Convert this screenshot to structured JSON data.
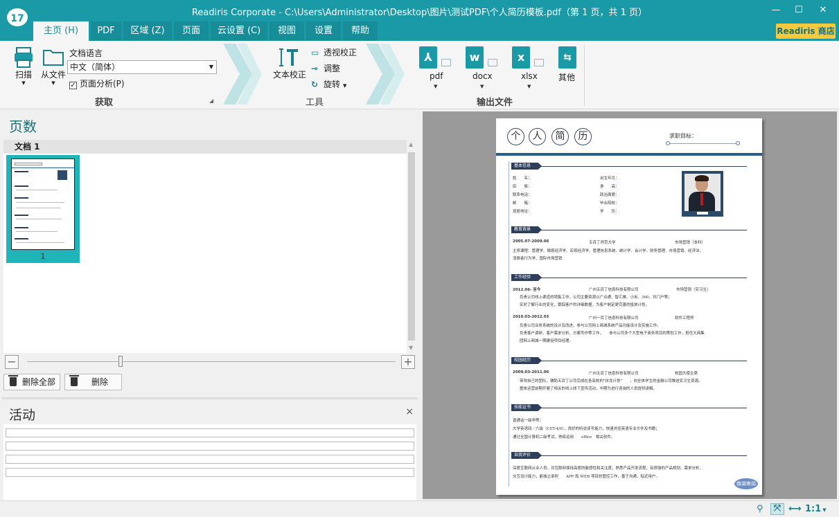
{
  "window": {
    "logo": "17",
    "title": "Readiris Corporate - C:\\Users\\Administrator\\Desktop\\图片\\测试PDF\\个人简历模板.pdf（第 1 页，共 1 页）",
    "minimize": "—",
    "maximize": "☐",
    "close": "✕"
  },
  "tabs": [
    {
      "label": "主页 (H)"
    },
    {
      "label": "PDF"
    },
    {
      "label": "区域 (Z)"
    },
    {
      "label": "页面"
    },
    {
      "label": "云设置 (C)"
    },
    {
      "label": "视图"
    },
    {
      "label": "设置"
    },
    {
      "label": "帮助"
    }
  ],
  "store_button": "Readiris 商店",
  "ribbon": {
    "acquire": {
      "scan": "扫描",
      "from_file": "从文件",
      "language_label": "文档语言",
      "language_value": "中文（简体）",
      "page_analysis": "页面分析(P)",
      "group_title": "获取"
    },
    "tools": {
      "text_correction": "文本校正",
      "perspective": "透视校正",
      "adjust": "调整",
      "rotate": "旋转",
      "group_title": "工具"
    },
    "output": {
      "pdf": "pdf",
      "docx": "docx",
      "xlsx": "xlsx",
      "other": "其他",
      "group_title": "输出文件"
    }
  },
  "pages_panel": {
    "title": "页数",
    "doc_name": "文档 1",
    "thumb_page_number": "1",
    "delete_all": "删除全部",
    "delete": "删除"
  },
  "activity_panel": {
    "title": "活动",
    "close": "×"
  },
  "document": {
    "title_chars": [
      "个",
      "人",
      "简",
      "历"
    ],
    "goal_label": "求职目标：",
    "sections": [
      "基本信息",
      "教育背景",
      "工作经验",
      "校园经历",
      "技能证书",
      "自我评价"
    ],
    "basic_info": {
      "left": [
        "姓　　名：",
        "民　　族：",
        "联系电话：",
        "邮　　箱：",
        "现居地址："
      ],
      "right": [
        "出生年月：",
        "身　　高：",
        "政治面貌：",
        "毕业院校：",
        "学　　历："
      ]
    },
    "education": {
      "date": "2005.07-2009.06",
      "school": "五百丁师范大学",
      "major": "市场营销（本科）",
      "line1": "主修课程：管理学、微观经济学、宏观经济学、管理信息系统、统计学、会计学、财务管理、市场营销、经济法、",
      "line2": "消费者行为学、国际市场营销"
    },
    "work": [
      {
        "date": "2012.06- 至今",
        "company": "广州五百丁信息科技有限公司",
        "role": "市场营销（实习生）",
        "lines": [
          "负责公司线上渠道的销售工作，公司主要资源以广点通、智汇推、小米、360、讯门户等；",
          "实时了解行业的变化，跟踪客户的详细数据，为客户制定更完善的投放计划。"
        ]
      },
      {
        "date": "2010.03-2012.03",
        "company": "广州一百丁信息科技有限公司",
        "role": "软件工程师",
        "lines": [
          "负责公司业务系统的设计及改进，参与公司网上商城系统产品功能设计及实施工作。",
          "负责客户调研、客户需求分析、方案写作等工作，　　参与公司多个大型电子商务项目的策划工作，担任大商集",
          "团网上商城一期建设项目经理。"
        ]
      }
    ],
    "campus": {
      "date": "2009.03-2011.06",
      "company": "广州五百丁信息科技有限公司",
      "role": "校园大使主席",
      "lines": [
        "带领自己的团队，辅助五百丁公司完成在各高校的\"扶龙计划\"　　，向全体学生的金融公司推送实习生资源。",
        "整体运营前期开展了相关的线上线下宣传活动，中期为进行咨询的人员提供讲解。"
      ]
    },
    "skills": [
      "普通话一级甲等；",
      "大学英语四／六级（CET-4/6），良好的听说读写能力，快速浏览英语专业文件及书籍；",
      "通过全国计算机二级考试，熟练运用　　office　相关软件。"
    ],
    "self_eval": [
      "深度互联网从业人员，对互联网保持高度的敏感性和关注度，熟悉产品开发流程，有很强的产品规划、需求分析、",
      "交互设计能力，能独立承担　　APP 和 WEB 项目的管控工作，善于沟通，贴近用户。"
    ],
    "stamp": "南湖审阅"
  },
  "statusbar": {
    "zoom_label": "1:1"
  }
}
